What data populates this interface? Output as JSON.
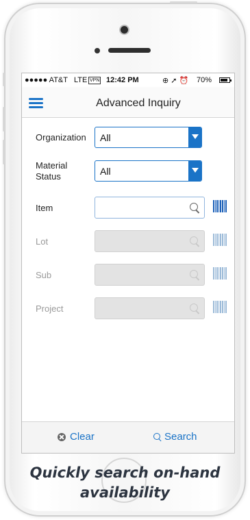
{
  "status_bar": {
    "carrier": "●●●●● AT&T",
    "network": "LTE",
    "vpn": "VPN",
    "time": "12:42 PM",
    "indicators": "⊕ ➚ ⏰",
    "battery_pct": "70%"
  },
  "header": {
    "title": "Advanced Inquiry",
    "menu_icon": "hamburger-menu-icon"
  },
  "form": {
    "organization": {
      "label": "Organization",
      "value": "All"
    },
    "material_status": {
      "label_line1": "Material",
      "label_line2": "Status",
      "value": "All"
    },
    "item": {
      "label": "Item",
      "value": ""
    },
    "lot": {
      "label": "Lot",
      "value": ""
    },
    "sub": {
      "label": "Sub",
      "value": ""
    },
    "project": {
      "label": "Project",
      "value": ""
    }
  },
  "footer": {
    "clear_label": "Clear",
    "search_label": "Search"
  },
  "caption": {
    "line1": "Quickly search on-hand",
    "line2": "availability"
  },
  "colors": {
    "accent": "#1a73c7",
    "barcode": "#1a5fb8",
    "disabled_field": "#e3e3e3",
    "caption": "#2c3440"
  }
}
